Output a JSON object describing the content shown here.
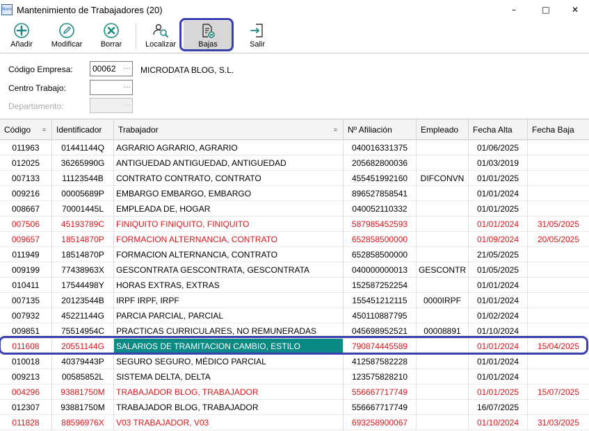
{
  "window": {
    "title": "Mantenimiento de Trabajadores (20)",
    "app_icon_text": "Nom",
    "minimize": "–",
    "maximize": "□",
    "close": "✕"
  },
  "toolbar": {
    "add_label": "Añadir",
    "modify_label": "Modificar",
    "delete_label": "Borrar",
    "locate_label": "Localizar",
    "bajas_label": "Bajas",
    "exit_label": "Salir",
    "accent": "#1e8a84",
    "highlight_color": "#3a3fb0"
  },
  "filters": {
    "empresa_label": "Código Empresa:",
    "empresa_value": "00062",
    "empresa_name": "MICRODATA BLOG, S.L.",
    "centro_label": "Centro Trabajo:",
    "centro_value": "",
    "departamento_label": "Departamento:",
    "departamento_value": "",
    "lookup_dots": "···"
  },
  "grid": {
    "columns": [
      "Código",
      "Identificador",
      "Trabajador",
      "Nº Afiliación",
      "Empleado",
      "Fecha Alta",
      "Fecha Baja"
    ],
    "rows": [
      {
        "code": "011963",
        "id": "01441144Q",
        "name": "AGRARIO AGRARIO, AGRARIO",
        "afil": "040016331375",
        "emp": "",
        "alta": "01/06/2025",
        "baja": "",
        "red": false
      },
      {
        "code": "012025",
        "id": "36265990G",
        "name": "ANTIGUEDAD ANTIGUEDAD, ANTIGUEDAD",
        "afil": "205682800036",
        "emp": "",
        "alta": "01/03/2019",
        "baja": "",
        "red": false
      },
      {
        "code": "007133",
        "id": "11123544B",
        "name": "CONTRATO CONTRATO, CONTRATO",
        "afil": "455451992160",
        "emp": "DIFCONVN",
        "alta": "01/01/2025",
        "baja": "",
        "red": false
      },
      {
        "code": "009216",
        "id": "00005689P",
        "name": "EMBARGO EMBARGO, EMBARGO",
        "afil": "896527858541",
        "emp": "",
        "alta": "01/01/2024",
        "baja": "",
        "red": false
      },
      {
        "code": "008667",
        "id": "70001445L",
        "name": "EMPLEADA DE, HOGAR",
        "afil": "040052110332",
        "emp": "",
        "alta": "01/01/2025",
        "baja": "",
        "red": false
      },
      {
        "code": "007506",
        "id": "45193789C",
        "name": "FINIQUITO FINIQUITO, FINIQUITO",
        "afil": "587985452593",
        "emp": "",
        "alta": "01/01/2024",
        "baja": "31/05/2025",
        "red": true
      },
      {
        "code": "009657",
        "id": "18514870P",
        "name": "FORMACION ALTERNANCIA, CONTRATO",
        "afil": "652858500000",
        "emp": "",
        "alta": "01/09/2024",
        "baja": "20/05/2025",
        "red": true
      },
      {
        "code": "011949",
        "id": "18514870P",
        "name": "FORMACION ALTERNANCIA, CONTRATO",
        "afil": "652858500000",
        "emp": "",
        "alta": "21/05/2025",
        "baja": "",
        "red": false
      },
      {
        "code": "009199",
        "id": "77438963X",
        "name": "GESCONTRATA GESCONTRATA, GESCONTRATA",
        "afil": "040000000013",
        "emp": "GESCONTR",
        "alta": "01/05/2025",
        "baja": "",
        "red": false
      },
      {
        "code": "010411",
        "id": "17544498Y",
        "name": "HORAS EXTRAS, EXTRAS",
        "afil": "152587252254",
        "emp": "",
        "alta": "01/01/2024",
        "baja": "",
        "red": false
      },
      {
        "code": "007135",
        "id": "20123544B",
        "name": "IRPF IRPF, IRPF",
        "afil": "155451212115",
        "emp": "0000IRPF",
        "alta": "01/01/2024",
        "baja": "",
        "red": false
      },
      {
        "code": "007932",
        "id": "45221144G",
        "name": "PARCIA PARCIAL, PARCIAL",
        "afil": "450110887795",
        "emp": "",
        "alta": "01/02/2024",
        "baja": "",
        "red": false
      },
      {
        "code": "009851",
        "id": "75514954C",
        "name": "PRACTICAS CURRICULARES, NO REMUNERADAS",
        "afil": "045698952521",
        "emp": "00008891",
        "alta": "01/10/2024",
        "baja": "",
        "red": false
      },
      {
        "code": "011608",
        "id": "20551144G",
        "name": "SALARIOS DE TRAMITACION CAMBIO, ESTILO",
        "afil": "790874445589",
        "emp": "",
        "alta": "01/01/2024",
        "baja": "15/04/2025",
        "red": true,
        "selected": true
      },
      {
        "code": "010018",
        "id": "40379443P",
        "name": "SEGURO SEGURO, MÉDICO PARCIAL",
        "afil": "412587582228",
        "emp": "",
        "alta": "01/01/2024",
        "baja": "",
        "red": false
      },
      {
        "code": "009213",
        "id": "00585852L",
        "name": "SISTEMA DELTA, DELTA",
        "afil": "123575828210",
        "emp": "",
        "alta": "01/01/2024",
        "baja": "",
        "red": false
      },
      {
        "code": "004296",
        "id": "93881750M",
        "name": "TRABAJADOR BLOG, TRABAJADOR",
        "afil": "556667717749",
        "emp": "",
        "alta": "01/01/2025",
        "baja": "15/07/2025",
        "red": true
      },
      {
        "code": "012307",
        "id": "93881750M",
        "name": "TRABAJADOR BLOG, TRABAJADOR",
        "afil": "556667717749",
        "emp": "",
        "alta": "16/07/2025",
        "baja": "",
        "red": false
      },
      {
        "code": "011828",
        "id": "88596976X",
        "name": "V03 TRABAJADOR, V03",
        "afil": "693258900067",
        "emp": "",
        "alta": "01/10/2024",
        "baja": "31/03/2025",
        "red": true
      }
    ]
  }
}
